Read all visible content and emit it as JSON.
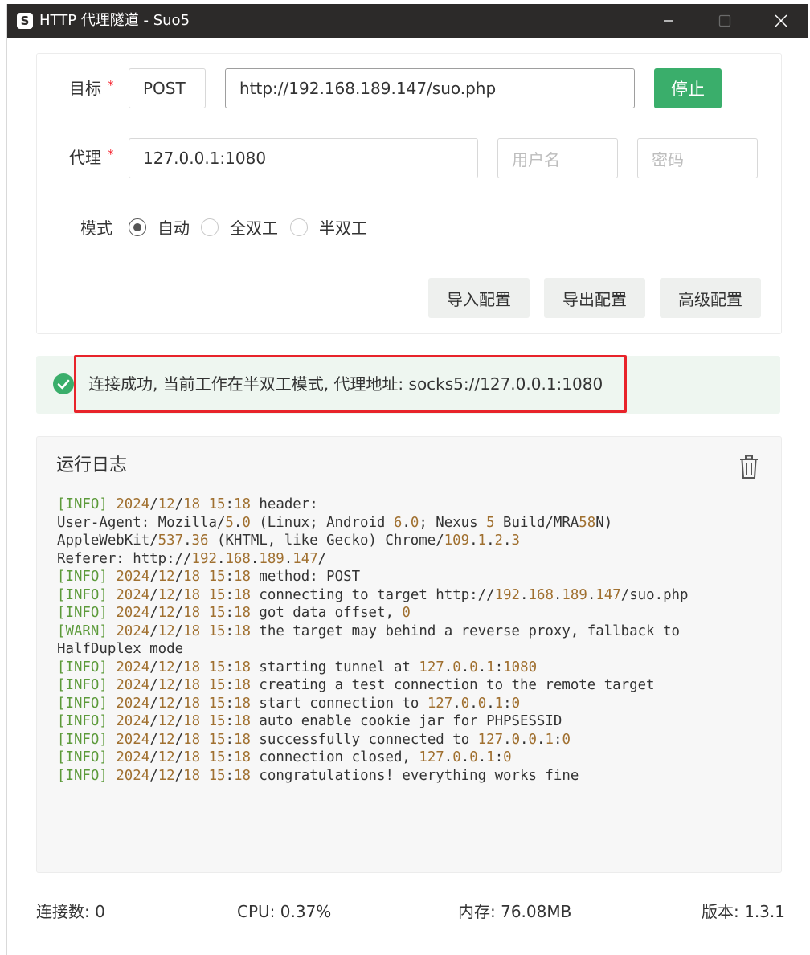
{
  "window": {
    "app_icon": "S",
    "title": "HTTP 代理隧道 - Suo5"
  },
  "config": {
    "target_label": "目标",
    "target_method": "POST",
    "target_url": "http://192.168.189.147/suo.php",
    "stop_label": "停止",
    "proxy_label": "代理",
    "proxy_value": "127.0.0.1:1080",
    "username_placeholder": "用户名",
    "password_placeholder": "密码",
    "required_mark": "*",
    "mode_label": "模式",
    "modes": [
      {
        "label": "自动",
        "checked": true
      },
      {
        "label": "全双工",
        "checked": false
      },
      {
        "label": "半双工",
        "checked": false
      }
    ],
    "import_label": "导入配置",
    "export_label": "导出配置",
    "advanced_label": "高级配置"
  },
  "status": {
    "message": "连接成功, 当前工作在半双工模式, 代理地址: socks5://127.0.0.1:1080",
    "icon": "check-circle-icon",
    "color": "#3aae6b"
  },
  "log": {
    "title": "运行日志",
    "lines": [
      "[INFO] 2024/12/18 15:18 header:",
      "User-Agent: Mozilla/5.0 (Linux; Android 6.0; Nexus 5 Build/MRA58N)",
      "AppleWebKit/537.36 (KHTML, like Gecko) Chrome/109.1.2.3",
      "Referer: http://192.168.189.147/",
      "[INFO] 2024/12/18 15:18 method: POST",
      "[INFO] 2024/12/18 15:18 connecting to target http://192.168.189.147/suo.php",
      "[INFO] 2024/12/18 15:18 got data offset, 0",
      "[WARN] 2024/12/18 15:18 the target may behind a reverse proxy, fallback to",
      "HalfDuplex mode",
      "[INFO] 2024/12/18 15:18 starting tunnel at 127.0.0.1:1080",
      "[INFO] 2024/12/18 15:18 creating a test connection to the remote target",
      "[INFO] 2024/12/18 15:18 start connection to 127.0.0.1:0",
      "[INFO] 2024/12/18 15:18 auto enable cookie jar for PHPSESSID",
      "[INFO] 2024/12/18 15:18 successfully connected to 127.0.0.1:0",
      "[INFO] 2024/12/18 15:18 connection closed, 127.0.0.1:0",
      "[INFO] 2024/12/18 15:18 congratulations! everything works fine"
    ]
  },
  "footer": {
    "connections": "连接数: 0",
    "cpu": "CPU: 0.37%",
    "memory": "内存: 76.08MB",
    "version": "版本: 1.3.1"
  }
}
